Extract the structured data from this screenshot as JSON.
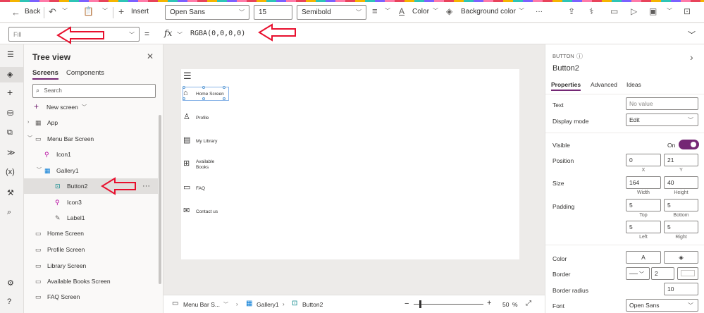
{
  "toolbar": {
    "back": "Back",
    "insert": "Insert",
    "font": "Open Sans",
    "font_size": "15",
    "font_weight": "Semibold",
    "color": "Color",
    "background_color": "Background color",
    "more": "···"
  },
  "formula_bar": {
    "property": "Fill",
    "equals": "=",
    "fx": "fx",
    "formula": "RGBA(0,0,0,0)"
  },
  "tree_view": {
    "title": "Tree view",
    "tabs": [
      "Screens",
      "Components"
    ],
    "search_placeholder": "Search",
    "new_screen": "New screen",
    "items": [
      {
        "label": "App"
      },
      {
        "label": "Menu Bar Screen"
      },
      {
        "label": "Icon1"
      },
      {
        "label": "Gallery1"
      },
      {
        "label": "Button2"
      },
      {
        "label": "Icon3"
      },
      {
        "label": "Label1"
      },
      {
        "label": "Home Screen"
      },
      {
        "label": "Profile Screen"
      },
      {
        "label": "Library Screen"
      },
      {
        "label": "Available Books Screen"
      },
      {
        "label": "FAQ Screen"
      }
    ]
  },
  "canvas": {
    "menu_items": [
      "Home Screen",
      "Profile",
      "My Library",
      "Available Books",
      "FAQ",
      "Contact us"
    ]
  },
  "bottom_bar": {
    "screen": "Menu Bar S...",
    "gallery": "Gallery1",
    "button": "Button2",
    "zoom": "50",
    "zoom_unit": "%"
  },
  "properties": {
    "type": "BUTTON",
    "name": "Button2",
    "tabs": [
      "Properties",
      "Advanced",
      "Ideas"
    ],
    "text_label": "Text",
    "text_placeholder": "No value",
    "display_mode_label": "Display mode",
    "display_mode": "Edit",
    "visible_label": "Visible",
    "visible_value": "On",
    "position_label": "Position",
    "x": "0",
    "y": "21",
    "x_label": "X",
    "y_label": "Y",
    "size_label": "Size",
    "width": "164",
    "height": "40",
    "width_label": "Width",
    "height_label": "Height",
    "padding_label": "Padding",
    "pad_top": "5",
    "pad_bottom": "5",
    "pad_left": "5",
    "pad_right": "5",
    "top_label": "Top",
    "bottom_label": "Bottom",
    "left_label": "Left",
    "right_label": "Right",
    "color_label": "Color",
    "color_a": "A",
    "border_label": "Border",
    "border_width": "2",
    "border_radius_label": "Border radius",
    "border_radius": "10",
    "font_label": "Font",
    "font": "Open Sans"
  },
  "colors": {
    "accent": "#742774",
    "arrow": "#e8102e"
  }
}
